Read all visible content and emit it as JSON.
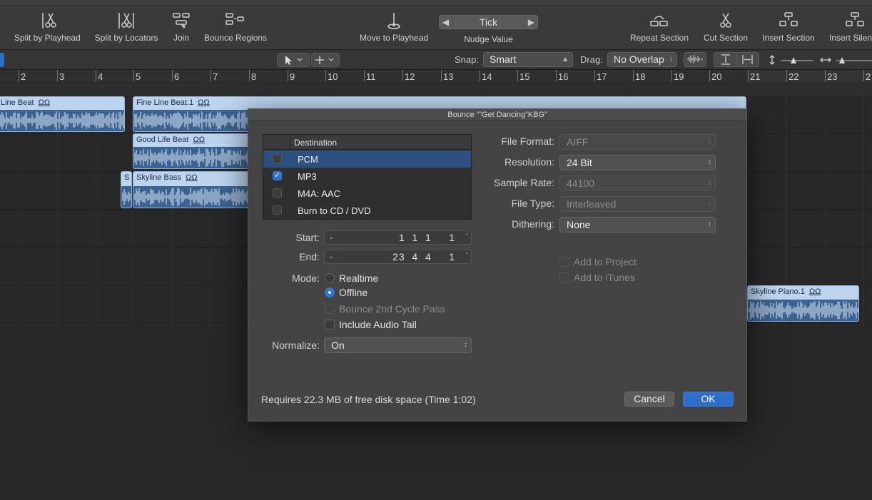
{
  "toolbar": {
    "items": [
      {
        "label": "Split by Playhead",
        "icon": "scissors-playhead-icon"
      },
      {
        "label": "Split by Locators",
        "icon": "scissors-locators-icon"
      },
      {
        "label": "Join",
        "icon": "join-icon"
      },
      {
        "label": "Bounce Regions",
        "icon": "bounce-regions-icon"
      },
      {
        "label": "Move to Playhead",
        "icon": "move-to-playhead-icon"
      },
      {
        "label": "Repeat Section",
        "icon": "repeat-section-icon"
      },
      {
        "label": "Cut Section",
        "icon": "cut-section-icon"
      },
      {
        "label": "Insert Section",
        "icon": "insert-section-icon"
      },
      {
        "label": "Insert Silen",
        "icon": "insert-silence-icon"
      }
    ],
    "nudge": {
      "value": "Tick",
      "label": "Nudge Value"
    }
  },
  "editbar": {
    "snap_label": "Snap:",
    "snap_value": "Smart",
    "drag_label": "Drag:",
    "drag_value": "No Overlap"
  },
  "ruler": {
    "bars": [
      "2",
      "3",
      "4",
      "5",
      "6",
      "7",
      "8",
      "9",
      "10",
      "11",
      "12",
      "13",
      "14",
      "15",
      "16",
      "17",
      "18",
      "19",
      "20",
      "21",
      "22",
      "23",
      "2"
    ]
  },
  "regions": [
    {
      "name": "Line Beat",
      "loop": "ΩΩ"
    },
    {
      "name": "Fine Line Beat.1",
      "loop": "ΩΩ"
    },
    {
      "name": "Good Life Beat",
      "loop": "ΩΩ"
    },
    {
      "name": "S",
      "loop": ""
    },
    {
      "name": "Skyline Bass",
      "loop": "ΩΩ"
    },
    {
      "name": "Skyline Piano.1",
      "loop": "ΩΩ"
    }
  ],
  "dialog": {
    "title": "Bounce “”Get Dancing”KBG”",
    "destination_header": "Destination",
    "destinations": [
      {
        "label": "PCM",
        "checked": false,
        "selected": true
      },
      {
        "label": "MP3",
        "checked": true,
        "selected": false
      },
      {
        "label": "M4A: AAC",
        "checked": false,
        "selected": false
      },
      {
        "label": "Burn to CD / DVD",
        "checked": false,
        "selected": false
      }
    ],
    "start_label": "Start:",
    "start_value": "1  1  1     1",
    "end_label": "End:",
    "end_value": "23  4  4     1",
    "mode_label": "Mode:",
    "mode_realtime": "Realtime",
    "mode_offline": "Offline",
    "bounce_2nd_cycle": "Bounce 2nd Cycle Pass",
    "include_audio_tail": "Include Audio Tail",
    "normalize_label": "Normalize:",
    "normalize_value": "On",
    "file_format_label": "File Format:",
    "file_format_value": "AIFF",
    "resolution_label": "Resolution:",
    "resolution_value": "24 Bit",
    "sample_rate_label": "Sample Rate:",
    "sample_rate_value": "44100",
    "file_type_label": "File Type:",
    "file_type_value": "Interleaved",
    "dithering_label": "Dithering:",
    "dithering_value": "None",
    "add_to_project": "Add to Project",
    "add_to_itunes": "Add to iTunes",
    "footer_text": "Requires 22.3 MB of free disk space  (Time 1:02)",
    "cancel": "Cancel",
    "ok": "OK"
  }
}
